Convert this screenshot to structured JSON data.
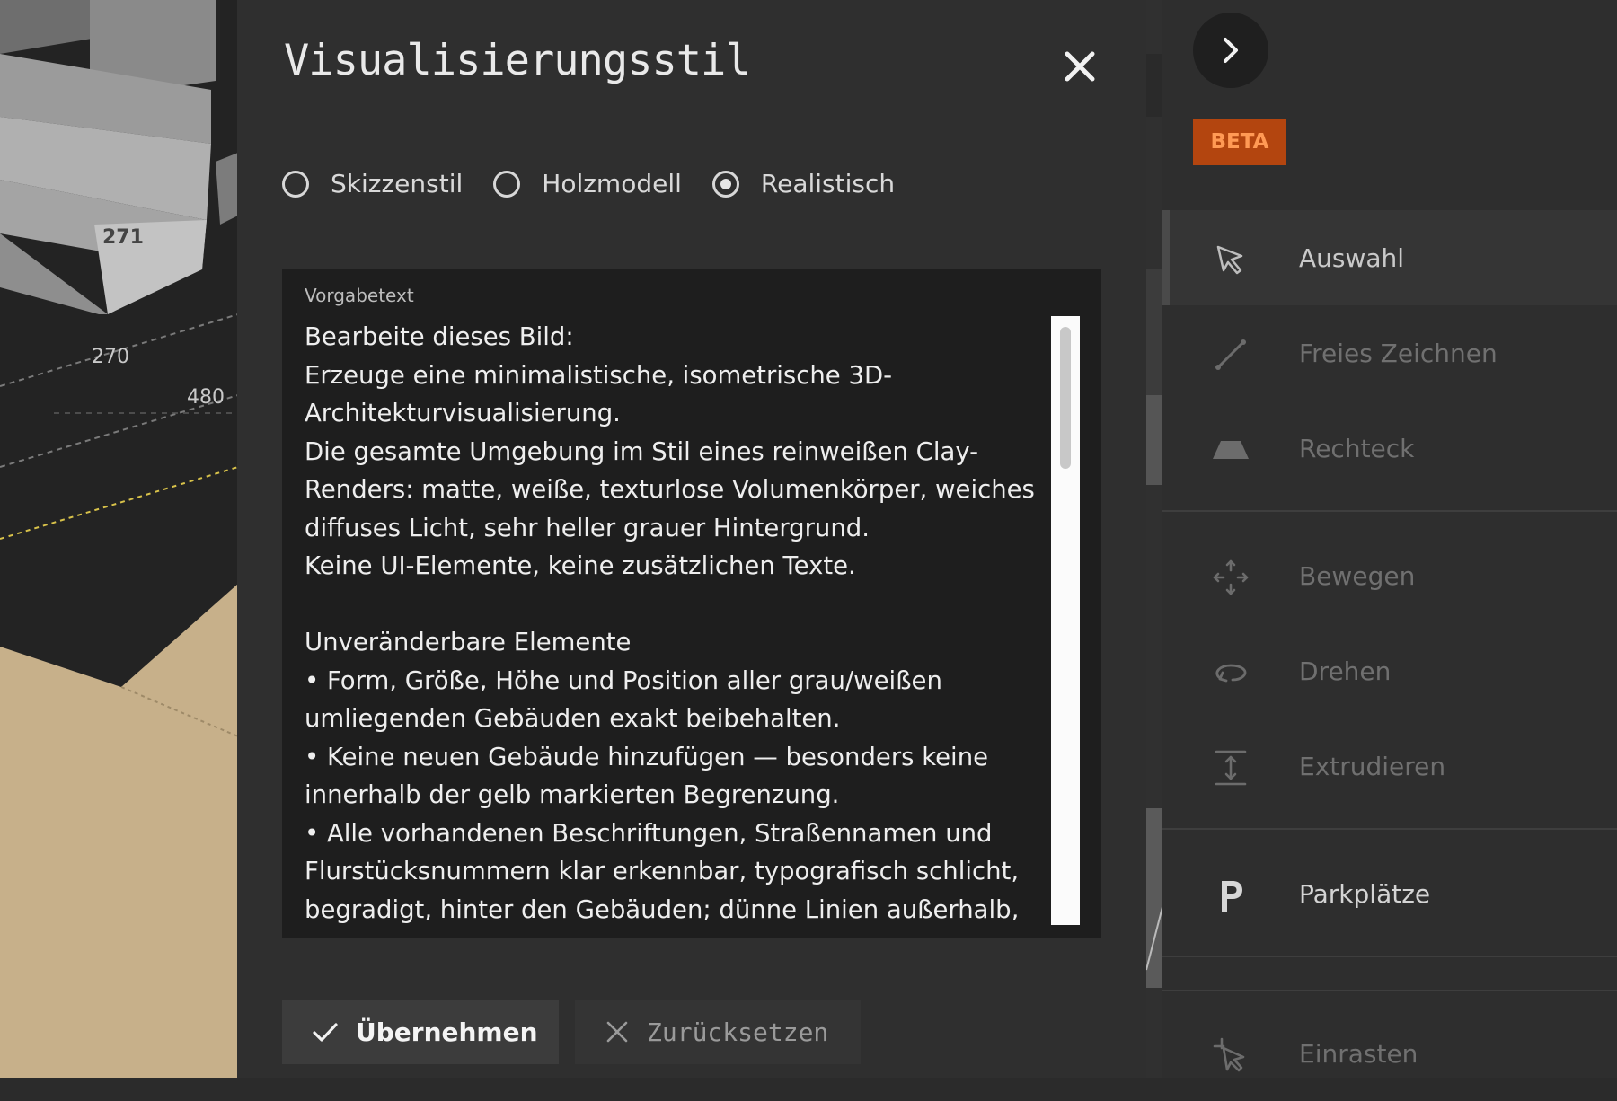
{
  "map": {
    "labels": [
      "271",
      "270",
      "480"
    ]
  },
  "dialog": {
    "title": "Visualisierungsstil",
    "options": [
      {
        "label": "Skizzenstil",
        "selected": false
      },
      {
        "label": "Holzmodell",
        "selected": false
      },
      {
        "label": "Realistisch",
        "selected": true
      }
    ],
    "prompt": {
      "caption": "Vorgabetext",
      "text": "Bearbeite dieses Bild:\nErzeuge eine minimalistische, isometrische 3D-Architekturvisualisierung.\nDie gesamte Umgebung im Stil eines reinweißen Clay-Renders: matte, weiße, texturlose Volumenkörper, weiches diffuses Licht, sehr heller grauer Hintergrund.\nKeine UI-Elemente, keine zusätzlichen Texte.\n\nUnveränderbare Elemente\n• Form, Größe, Höhe und Position aller grau/weißen umliegenden Gebäuden exakt beibehalten.\n• Keine neuen Gebäude hinzufügen — besonders keine innerhalb der gelb markierten Begrenzung.\n• Alle vorhandenen Beschriftungen, Straßennamen und Flurstücksnummern klar erkennbar, typografisch schlicht, begradigt, hinter den Gebäuden; dünne Linien außerhalb,"
    },
    "apply_label": "Übernehmen",
    "reset_label": "Zurücksetzen"
  },
  "toolbar": {
    "beta_label": "BETA",
    "tools": [
      {
        "id": "selection",
        "label": "Auswahl",
        "icon": "cursor-arrow-icon",
        "state": "active"
      },
      {
        "id": "freehand",
        "label": "Freies Zeichnen",
        "icon": "line-draw-icon",
        "state": "dim"
      },
      {
        "id": "rectangle",
        "label": "Rechteck",
        "icon": "trapezoid-icon",
        "state": "dim"
      },
      {
        "id": "move",
        "label": "Bewegen",
        "icon": "move-arrows-icon",
        "state": "dim"
      },
      {
        "id": "rotate",
        "label": "Drehen",
        "icon": "rotate-icon",
        "state": "dim"
      },
      {
        "id": "extrude",
        "label": "Extrudieren",
        "icon": "extrude-icon",
        "state": "dim"
      },
      {
        "id": "parking",
        "label": "Parkplätze",
        "icon": "parking-p-icon",
        "state": "bright"
      },
      {
        "id": "snap",
        "label": "Einrasten",
        "icon": "snap-cursor-icon",
        "state": "dim"
      }
    ]
  },
  "colors": {
    "dialog_bg": "#2f2f2f",
    "prompt_bg": "#1e1e1e",
    "beta_bg": "#b3450f",
    "beta_text": "#ff9a55",
    "plot_fill": "#c7b08a"
  }
}
